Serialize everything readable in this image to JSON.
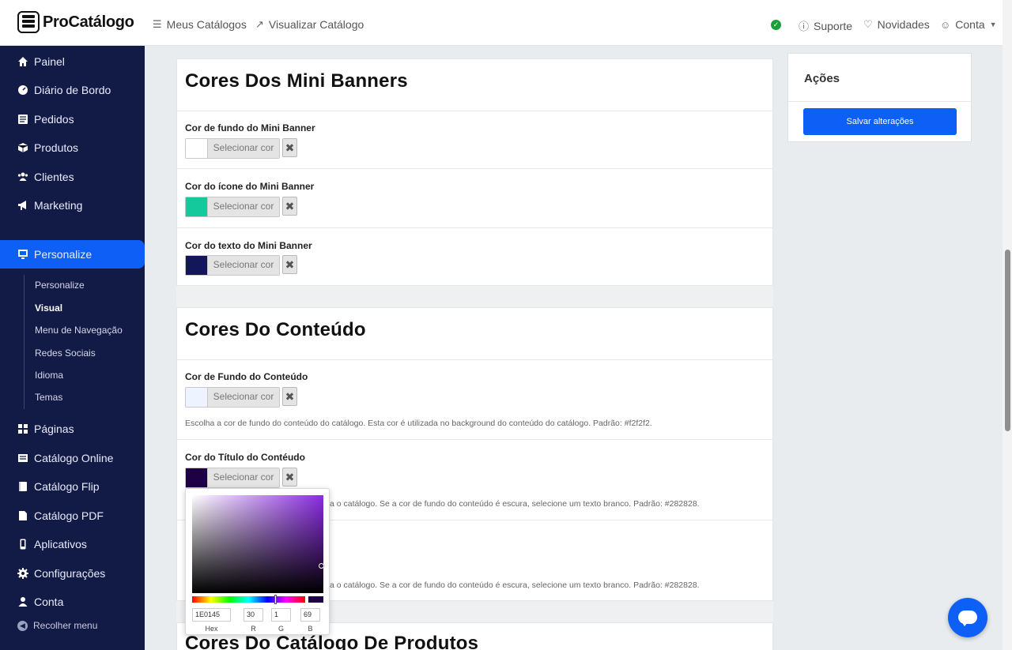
{
  "brand": {
    "name": "ProCatálogo"
  },
  "topnav": {
    "my_catalogs": "Meus Catálogos",
    "view_catalog": "Visualizar Catálogo",
    "support": "Suporte",
    "news": "Novidades",
    "account": "Conta"
  },
  "sidebar": {
    "items": [
      {
        "label": "Painel",
        "icon": "home-icon"
      },
      {
        "label": "Diário de Bordo",
        "icon": "gauge-icon"
      },
      {
        "label": "Pedidos",
        "icon": "list-icon"
      },
      {
        "label": "Produtos",
        "icon": "box-icon"
      },
      {
        "label": "Clientes",
        "icon": "users-icon"
      },
      {
        "label": "Marketing",
        "icon": "megaphone-icon"
      },
      {
        "label": "Personalize",
        "icon": "monitor-icon",
        "active": true
      }
    ],
    "subitems": [
      "Personalize",
      "Visual",
      "Menu de Navegação",
      "Redes Sociais",
      "Idioma",
      "Temas"
    ],
    "items2": [
      {
        "label": "Páginas",
        "icon": "grid-icon"
      },
      {
        "label": "Catálogo Online",
        "icon": "catalog-icon"
      },
      {
        "label": "Catálogo Flip",
        "icon": "book-icon"
      },
      {
        "label": "Catálogo PDF",
        "icon": "pdf-icon"
      },
      {
        "label": "Aplicativos",
        "icon": "phone-icon"
      },
      {
        "label": "Configurações",
        "icon": "gear-icon"
      },
      {
        "label": "Conta",
        "icon": "user-icon"
      }
    ],
    "collapse": "Recolher menu"
  },
  "sections": {
    "mini_banners": {
      "title": "Cores Dos Mini Banners",
      "fields": [
        {
          "label": "Cor de fundo do Mini Banner",
          "color": "#ffffff",
          "button": "Selecionar cor"
        },
        {
          "label": "Cor do ícone do Mini Banner",
          "color": "#14c99b",
          "button": "Selecionar cor"
        },
        {
          "label": "Cor do texto do Mini Banner",
          "color": "#14165a",
          "button": "Selecionar cor"
        }
      ]
    },
    "content": {
      "title": "Cores Do Conteúdo",
      "fields": [
        {
          "label": "Cor de Fundo do Conteúdo",
          "color": "#eef4ff",
          "button": "Selecionar cor",
          "help": "Escolha a cor de fundo do conteúdo do catálogo. Esta cor é utilizada no background do conteúdo do catálogo. Padrão: #f2f2f2."
        },
        {
          "label": "Cor do Título do Contéudo",
          "color": "#1E0145",
          "button": "Selecionar cor",
          "help": "a o catálogo. Se a cor de fundo do conteúdo é escura, selecione um texto branco. Padrão: #282828."
        }
      ],
      "help3": "a o catálogo. Se a cor de fundo do conteúdo é escura, selecione um texto branco. Padrão: #282828."
    },
    "products": {
      "title": "Cores Do Catálogo De Produtos"
    }
  },
  "actions": {
    "title": "Ações",
    "save": "Salvar alterações"
  },
  "picker": {
    "hex": "1E0145",
    "r": "30",
    "g": "1",
    "b": "69",
    "labels": {
      "hex": "Hex",
      "r": "R",
      "g": "G",
      "b": "B"
    }
  }
}
